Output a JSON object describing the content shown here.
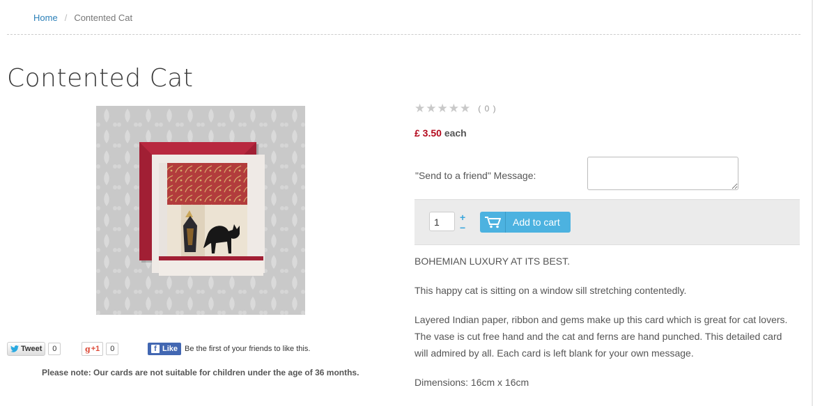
{
  "breadcrumb": {
    "home": "Home",
    "separator": "/",
    "current": "Contented Cat"
  },
  "product": {
    "title": "Contented Cat",
    "rating_count": "( 0 )",
    "price": "£ 3.50",
    "price_unit": "each",
    "message_label": "\"Send to a friend\" Message:",
    "message_value": "",
    "quantity": "1",
    "plus": "+",
    "minus": "−",
    "add_to_cart": "Add to cart",
    "description": [
      "BOHEMIAN LUXURY AT ITS BEST.",
      "This happy cat is sitting on a window sill stretching contentedly.",
      "Layered Indian paper, ribbon and gems make up this card which is great for cat lovers. The vase is cut free hand and the cat and ferns are hand punched. This detailed card will admired by all. Each card is left blank for your own message.",
      "Dimensions: 16cm x 16cm"
    ]
  },
  "social": {
    "tweet_label": "Tweet",
    "tweet_count": "0",
    "gplus_label": "+1",
    "gplus_count": "0",
    "fb_label": "Like",
    "fb_text": "Be the first of your friends to like this."
  },
  "note": "Please note: Our cards are not suitable for children under the age of 36 months.",
  "colors": {
    "link": "#2a7fb8",
    "price": "#b3071b",
    "cart_button": "#4cb2e0",
    "facebook": "#4267b2"
  }
}
